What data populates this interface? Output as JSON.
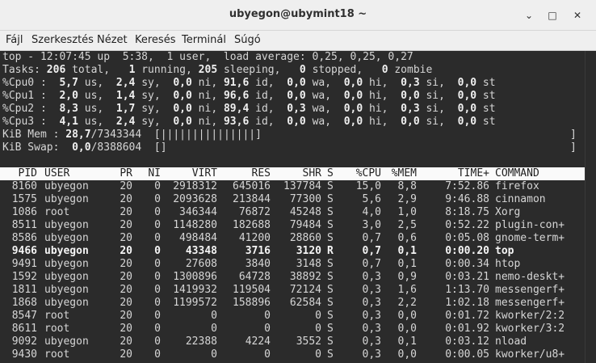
{
  "window": {
    "title": "ubyegon@ubymint18 ~",
    "minimize": "⌄",
    "maximize": "□",
    "close": "✕"
  },
  "menu": [
    "Fájl",
    "Szerkesztés",
    "Nézet",
    "Keresés",
    "Terminál",
    "Súgó"
  ],
  "summary": {
    "uptime_line": "top - 12:07:45 up  5:38,  1 user,  load average: 0,25, 0,25, 0,27",
    "tasks": {
      "label": "Tasks:",
      "total": "206",
      "total_label": "total,",
      "running": "1",
      "running_label": "running,",
      "sleeping": "205",
      "sleeping_label": "sleeping,",
      "stopped": "0",
      "stopped_label": "stopped,",
      "zombie": "0",
      "zombie_label": "zombie"
    },
    "cpus": [
      {
        "name": "%Cpu0",
        "us": "5,7",
        "sy": "2,4",
        "ni": "0,0",
        "id": "91,6",
        "wa": "0,0",
        "hi": "0,0",
        "si": "0,3",
        "st": "0,0"
      },
      {
        "name": "%Cpu1",
        "us": "2,0",
        "sy": "1,4",
        "ni": "0,0",
        "id": "96,6",
        "wa": "0,0",
        "hi": "0,0",
        "si": "0,0",
        "st": "0,0"
      },
      {
        "name": "%Cpu2",
        "us": "8,3",
        "sy": "1,7",
        "ni": "0,0",
        "id": "89,4",
        "wa": "0,3",
        "hi": "0,0",
        "si": "0,3",
        "st": "0,0"
      },
      {
        "name": "%Cpu3",
        "us": "4,1",
        "sy": "2,4",
        "ni": "0,0",
        "id": "93,6",
        "wa": "0,0",
        "hi": "0,0",
        "si": "0,0",
        "st": "0,0"
      }
    ],
    "mem": {
      "label": "KiB Mem :",
      "used_pct": "28,7",
      "total": "7343344",
      "bar": "|||||||||||||||",
      "used_fraction": 0.287
    },
    "swap": {
      "label": "KiB Swap:",
      "used_pct": "0,0",
      "total": "8388604",
      "bar": "",
      "used_fraction": 0.0
    }
  },
  "columns": [
    "PID",
    "USER",
    "PR",
    "NI",
    "VIRT",
    "RES",
    "SHR",
    "S",
    "%CPU",
    "%MEM",
    "TIME+",
    "COMMAND"
  ],
  "processes": [
    {
      "pid": "8160",
      "user": "ubyegon",
      "pr": "20",
      "ni": "0",
      "virt": "2918312",
      "res": "645016",
      "shr": "137784",
      "s": "S",
      "cpu": "15,0",
      "mem": "8,8",
      "time": "7:52.86",
      "cmd": "firefox"
    },
    {
      "pid": "1575",
      "user": "ubyegon",
      "pr": "20",
      "ni": "0",
      "virt": "2093628",
      "res": "213844",
      "shr": "77300",
      "s": "S",
      "cpu": "5,6",
      "mem": "2,9",
      "time": "9:46.88",
      "cmd": "cinnamon"
    },
    {
      "pid": "1086",
      "user": "root",
      "pr": "20",
      "ni": "0",
      "virt": "346344",
      "res": "76872",
      "shr": "45248",
      "s": "S",
      "cpu": "4,0",
      "mem": "1,0",
      "time": "8:18.75",
      "cmd": "Xorg"
    },
    {
      "pid": "8511",
      "user": "ubyegon",
      "pr": "20",
      "ni": "0",
      "virt": "1148280",
      "res": "182688",
      "shr": "79484",
      "s": "S",
      "cpu": "3,0",
      "mem": "2,5",
      "time": "0:52.22",
      "cmd": "plugin-con+"
    },
    {
      "pid": "8586",
      "user": "ubyegon",
      "pr": "20",
      "ni": "0",
      "virt": "498484",
      "res": "41200",
      "shr": "28860",
      "s": "S",
      "cpu": "0,7",
      "mem": "0,6",
      "time": "0:05.08",
      "cmd": "gnome-term+"
    },
    {
      "pid": "9466",
      "user": "ubyegon",
      "pr": "20",
      "ni": "0",
      "virt": "43348",
      "res": "3716",
      "shr": "3120",
      "s": "R",
      "cpu": "0,7",
      "mem": "0,1",
      "time": "0:00.20",
      "cmd": "top",
      "bold": true
    },
    {
      "pid": "9491",
      "user": "ubyegon",
      "pr": "20",
      "ni": "0",
      "virt": "27608",
      "res": "3840",
      "shr": "3148",
      "s": "S",
      "cpu": "0,7",
      "mem": "0,1",
      "time": "0:00.34",
      "cmd": "htop"
    },
    {
      "pid": "1592",
      "user": "ubyegon",
      "pr": "20",
      "ni": "0",
      "virt": "1300896",
      "res": "64728",
      "shr": "38892",
      "s": "S",
      "cpu": "0,3",
      "mem": "0,9",
      "time": "0:03.21",
      "cmd": "nemo-deskt+"
    },
    {
      "pid": "1811",
      "user": "ubyegon",
      "pr": "20",
      "ni": "0",
      "virt": "1419932",
      "res": "119504",
      "shr": "72124",
      "s": "S",
      "cpu": "0,3",
      "mem": "1,6",
      "time": "1:13.70",
      "cmd": "messengerf+"
    },
    {
      "pid": "1868",
      "user": "ubyegon",
      "pr": "20",
      "ni": "0",
      "virt": "1199572",
      "res": "158896",
      "shr": "62584",
      "s": "S",
      "cpu": "0,3",
      "mem": "2,2",
      "time": "1:02.18",
      "cmd": "messengerf+"
    },
    {
      "pid": "8547",
      "user": "root",
      "pr": "20",
      "ni": "0",
      "virt": "0",
      "res": "0",
      "shr": "0",
      "s": "S",
      "cpu": "0,3",
      "mem": "0,0",
      "time": "0:01.72",
      "cmd": "kworker/2:2"
    },
    {
      "pid": "8611",
      "user": "root",
      "pr": "20",
      "ni": "0",
      "virt": "0",
      "res": "0",
      "shr": "0",
      "s": "S",
      "cpu": "0,3",
      "mem": "0,0",
      "time": "0:01.92",
      "cmd": "kworker/3:2"
    },
    {
      "pid": "9092",
      "user": "ubyegon",
      "pr": "20",
      "ni": "0",
      "virt": "22388",
      "res": "4224",
      "shr": "3552",
      "s": "S",
      "cpu": "0,3",
      "mem": "0,1",
      "time": "0:03.12",
      "cmd": "nload"
    },
    {
      "pid": "9430",
      "user": "root",
      "pr": "20",
      "ni": "0",
      "virt": "0",
      "res": "0",
      "shr": "0",
      "s": "S",
      "cpu": "0,3",
      "mem": "0,0",
      "time": "0:00.05",
      "cmd": "kworker/u8+"
    }
  ]
}
